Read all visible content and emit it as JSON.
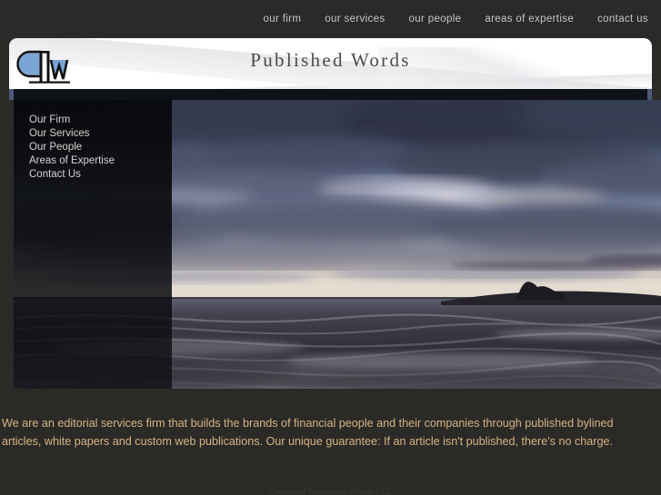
{
  "topnav": {
    "items": [
      {
        "label": "our firm"
      },
      {
        "label": "our services"
      },
      {
        "label": "our people"
      },
      {
        "label": "areas of expertise"
      },
      {
        "label": "contact us"
      }
    ]
  },
  "header": {
    "title": "Published Words",
    "logo_icon": "pw-monogram-logo",
    "logo_blue": "#7ba4d4",
    "logo_black": "#111111"
  },
  "sidebar": {
    "items": [
      {
        "label": "Our Firm"
      },
      {
        "label": "Our Services"
      },
      {
        "label": "Our People"
      },
      {
        "label": "Areas of Expertise"
      },
      {
        "label": "Contact Us"
      }
    ]
  },
  "hero": {
    "image_name": "ocean-sunset-clouds-photo",
    "alt": "Dramatic cloudy sky over ocean at dusk with dark headland on the right"
  },
  "content": {
    "intro": "We are an editorial services firm that builds the brands of financial people and their companies through published bylined articles, white papers and custom web publications. Our unique guarantee: If an article isn't published, there's no charge.",
    "footer": "Copyright Published Words LLC"
  },
  "colors": {
    "topbar_bg": "#2a2a2a",
    "page_bg": "#2b2a27",
    "navy_bar": "#4d5879",
    "accent_text": "#d6b485",
    "header_bg": "#ffffff"
  }
}
